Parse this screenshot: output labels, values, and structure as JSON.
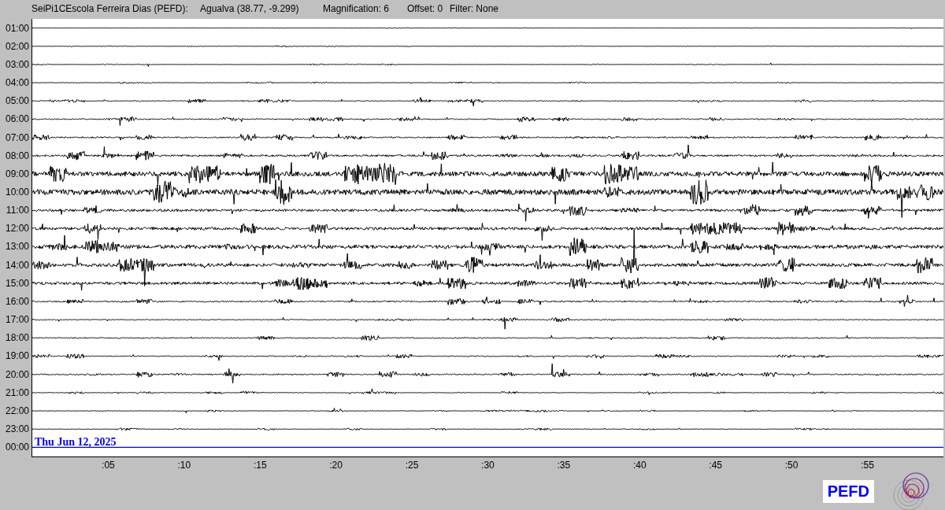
{
  "header": {
    "station": "SeiPi1CEscola Ferreira Dias (PEFD):",
    "location": "Agualva (38.77, -9.299)",
    "magnification": "Magnification: 6",
    "offset": "Offset: 0",
    "filter": "Filter: None"
  },
  "helicorder": {
    "rows": [
      {
        "label": "01:00",
        "current": false
      },
      {
        "label": "02:00",
        "current": false
      },
      {
        "label": "03:00",
        "current": false
      },
      {
        "label": "04:00",
        "current": false
      },
      {
        "label": "05:00",
        "current": false
      },
      {
        "label": "06:00",
        "current": false
      },
      {
        "label": "07:00",
        "current": false
      },
      {
        "label": "08:00",
        "current": false
      },
      {
        "label": "09:00",
        "current": false
      },
      {
        "label": "10:00",
        "current": false
      },
      {
        "label": "11:00",
        "current": false
      },
      {
        "label": "12:00",
        "current": false
      },
      {
        "label": "13:00",
        "current": false
      },
      {
        "label": "14:00",
        "current": false
      },
      {
        "label": "15:00",
        "current": false
      },
      {
        "label": "16:00",
        "current": false
      },
      {
        "label": "17:00",
        "current": false
      },
      {
        "label": "18:00",
        "current": false
      },
      {
        "label": "19:00",
        "current": false
      },
      {
        "label": "20:00",
        "current": false
      },
      {
        "label": "21:00",
        "current": false
      },
      {
        "label": "22:00",
        "current": false
      },
      {
        "label": "23:00",
        "current": false
      },
      {
        "label": "00:00",
        "current": true
      }
    ],
    "date": "Thu Jun 12, 2025",
    "minute_ticks": [
      ":05",
      ":10",
      ":15",
      ":20",
      ":25",
      ":30",
      ":35",
      ":40",
      ":45",
      ":50",
      ":55"
    ]
  },
  "logo": "PEFD"
}
